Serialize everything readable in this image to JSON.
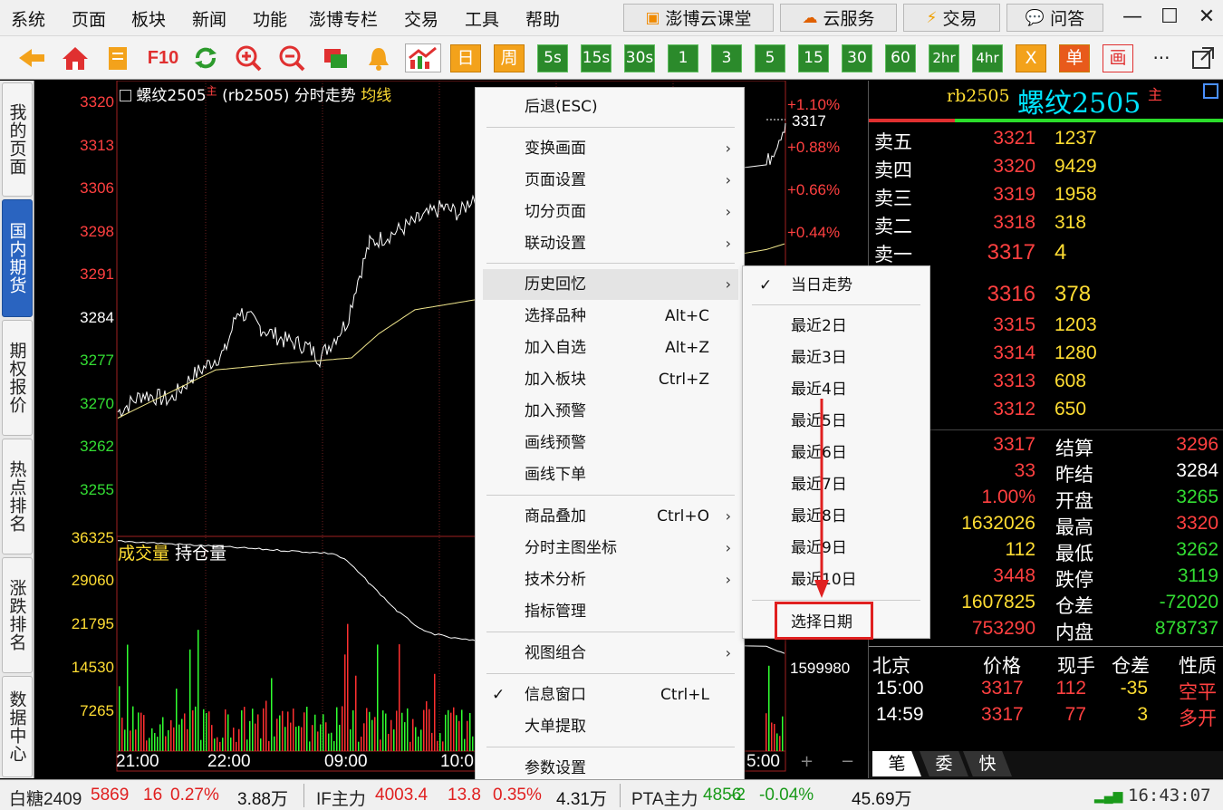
{
  "menubar": {
    "items": [
      "系统",
      "页面",
      "板块",
      "新闻",
      "功能",
      "澎博专栏",
      "交易",
      "工具",
      "帮助"
    ],
    "buttons": [
      "澎博云课堂",
      "云服务",
      "交易",
      "问答"
    ]
  },
  "toolbar": {
    "f10": "F10",
    "periods": [
      "日",
      "周",
      "5s",
      "15s",
      "30s",
      "1",
      "3",
      "5",
      "15",
      "30",
      "60",
      "2hr",
      "4hr"
    ],
    "extra": [
      "X",
      "单",
      "画"
    ],
    "more": "···"
  },
  "left_tabs": [
    "我的页面",
    "国内期货",
    "期权报价",
    "热点排名",
    "涨跌排名",
    "数据中心"
  ],
  "chart": {
    "header": {
      "name": "螺纹2505",
      "main_tag": "主",
      "code": "(rb2505)",
      "mode": "分时走势",
      "avg": "均线"
    },
    "left_prices": [
      "3320",
      "3313",
      "3306",
      "3298",
      "3291",
      "3284",
      "3277",
      "3270",
      "3262",
      "3255"
    ],
    "right_pcts": [
      "+1.10%",
      "+0.88%",
      "+0.66%",
      "+0.44%"
    ],
    "last_price": "3317",
    "volume_axis": [
      "36325",
      "29060",
      "21795",
      "14530",
      "7265"
    ],
    "volume_legend": {
      "vol": "成交量",
      "oi": "持仓量"
    },
    "oi_value": "1599980",
    "x_labels": [
      "21:00",
      "22:00",
      "09:00",
      "10:0",
      "5:00"
    ],
    "plus": "+",
    "minus": "−"
  },
  "context_menu": {
    "items": [
      {
        "label": "后退(ESC)"
      },
      {
        "label": "变换画面",
        "arrow": "›"
      },
      {
        "label": "页面设置",
        "arrow": "›"
      },
      {
        "label": "切分页面",
        "arrow": "›"
      },
      {
        "label": "联动设置",
        "arrow": "›"
      },
      {
        "label": "历史回忆",
        "arrow": "›"
      },
      {
        "label": "选择品种",
        "shortcut": "Alt+C"
      },
      {
        "label": "加入自选",
        "shortcut": "Alt+Z"
      },
      {
        "label": "加入板块",
        "shortcut": "Ctrl+Z"
      },
      {
        "label": "加入预警"
      },
      {
        "label": "画线预警"
      },
      {
        "label": "画线下单"
      },
      {
        "label": "商品叠加",
        "shortcut": "Ctrl+O",
        "arrow": "›"
      },
      {
        "label": "分时主图坐标",
        "arrow": "›"
      },
      {
        "label": "技术分析",
        "arrow": "›"
      },
      {
        "label": "指标管理"
      },
      {
        "label": "视图组合",
        "arrow": "›"
      },
      {
        "label": "信息窗口",
        "shortcut": "Ctrl+L",
        "check": "✓"
      },
      {
        "label": "大单提取"
      },
      {
        "label": "参数设置"
      }
    ]
  },
  "submenu": {
    "items": [
      "当日走势",
      "最近2日",
      "最近3日",
      "最近4日",
      "最近5日",
      "最近6日",
      "最近7日",
      "最近8日",
      "最近9日",
      "最近10日",
      "选择日期"
    ],
    "check": "✓"
  },
  "quote": {
    "code": "rb2505",
    "name": "螺纹2505",
    "tag": "主",
    "asks": [
      {
        "label": "卖五",
        "price": "3321",
        "vol": "1237"
      },
      {
        "label": "卖四",
        "price": "3320",
        "vol": "9429"
      },
      {
        "label": "卖三",
        "price": "3319",
        "vol": "1958"
      },
      {
        "label": "卖二",
        "price": "3318",
        "vol": "318"
      },
      {
        "label": "卖一",
        "price": "3317",
        "vol": "4"
      }
    ],
    "bids": [
      {
        "price": "3316",
        "vol": "378"
      },
      {
        "price": "3315",
        "vol": "1203"
      },
      {
        "price": "3314",
        "vol": "1280"
      },
      {
        "price": "3313",
        "vol": "608"
      },
      {
        "price": "3312",
        "vol": "650"
      }
    ],
    "stats": [
      {
        "v1": "3317",
        "k": "结算",
        "v2": "3296"
      },
      {
        "v1": "33",
        "k": "昨结",
        "v2": "3284"
      },
      {
        "v1": "1.00%",
        "k": "开盘",
        "v2": "3265"
      },
      {
        "v1": "1632026",
        "k": "最高",
        "v2": "3320"
      },
      {
        "v1": "112",
        "k": "最低",
        "v2": "3262"
      },
      {
        "v1": "3448",
        "k": "跌停",
        "v2": "3119"
      },
      {
        "v1": "1607825",
        "k": "仓差",
        "v2": "-72020"
      },
      {
        "v1": "753290",
        "k": "内盘",
        "v2": "878737"
      }
    ],
    "trades_header": [
      "北京",
      "价格",
      "现手",
      "仓差",
      "性质"
    ],
    "trades": [
      {
        "time": "15:00",
        "price": "3317",
        "vol": "112",
        "oi": "-35",
        "nature": "空平"
      },
      {
        "time": "14:59",
        "price": "3317",
        "vol": "77",
        "oi": "3",
        "nature": "多开"
      }
    ],
    "tabs": [
      "笔",
      "委",
      "快"
    ]
  },
  "status": {
    "items": [
      {
        "name": "白糖2409",
        "price": "5869",
        "chg": "16",
        "pct": "0.27%",
        "vol": "3.88万"
      },
      {
        "name": "IF主力",
        "price": "4003.4",
        "chg": "13.8",
        "pct": "0.35%",
        "vol": "4.31万"
      },
      {
        "name": "PTA主力",
        "price": "4856",
        "chg": "-2",
        "pct": "-0.04%",
        "vol": "45.69万"
      }
    ],
    "time": "16:43:07"
  },
  "colors": {
    "up": "#ff4040",
    "down": "#33dd33",
    "yellow": "#ffdd33",
    "highlight_box": "#e02020"
  }
}
